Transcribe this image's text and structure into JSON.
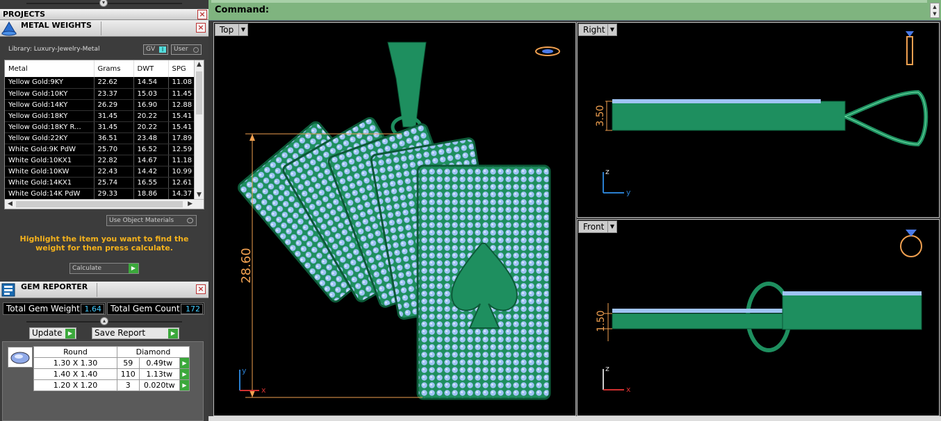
{
  "projects_panel": {
    "title": "PROJECTS"
  },
  "metal_weights": {
    "title": "METAL WEIGHTS",
    "library": "Library: Luxury-Jewelry-Metal",
    "gv_label": "GV",
    "user_label": "User",
    "columns": [
      "Metal",
      "Grams",
      "DWT",
      "SPG"
    ],
    "rows": [
      [
        "Yellow Gold:9KY",
        "22.62",
        "14.54",
        "11.08"
      ],
      [
        "Yellow Gold:10KY",
        "23.37",
        "15.03",
        "11.45"
      ],
      [
        "Yellow Gold:14KY",
        "26.29",
        "16.90",
        "12.88"
      ],
      [
        "Yellow Gold:18KY",
        "31.45",
        "20.22",
        "15.41"
      ],
      [
        "Yellow Gold:18KY R...",
        "31.45",
        "20.22",
        "15.41"
      ],
      [
        "Yellow Gold:22KY",
        "36.51",
        "23.48",
        "17.89"
      ],
      [
        "White Gold:9K PdW",
        "25.70",
        "16.52",
        "12.59"
      ],
      [
        "White Gold:10KX1",
        "22.82",
        "14.67",
        "11.18"
      ],
      [
        "White Gold:10KW",
        "22.43",
        "14.42",
        "10.99"
      ],
      [
        "White Gold:14KX1",
        "25.74",
        "16.55",
        "12.61"
      ],
      [
        "White Gold:14K PdW",
        "29.33",
        "18.86",
        "14.37"
      ]
    ],
    "use_object_materials": "Use Object Materials",
    "hint": "Highlight the item you want to find the weight for then press calculate.",
    "calculate_label": "Calculate"
  },
  "gem_reporter": {
    "title": "GEM REPORTER",
    "total_weight_label": "Total Gem Weight",
    "total_weight": "1.64",
    "total_count_label": "Total Gem Count",
    "total_count": "172",
    "update_label": "Update",
    "save_report_label": "Save Report",
    "shape": "Round",
    "material": "Diamond",
    "gems": [
      {
        "size": "1.30 X 1.30",
        "count": "59",
        "weight": "0.49tw"
      },
      {
        "size": "1.40 X 1.40",
        "count": "110",
        "weight": "1.13tw"
      },
      {
        "size": "1.20 X 1.20",
        "count": "3",
        "weight": "0.020tw"
      }
    ]
  },
  "command": {
    "label": "Command:"
  },
  "viewports": {
    "top": {
      "label": "Top",
      "dim_height": "28.60"
    },
    "right": {
      "label": "Right",
      "dim": "3.50"
    },
    "front": {
      "label": "Front",
      "dim": "1.50"
    }
  },
  "axes": {
    "x": "x",
    "y": "y",
    "z": "z"
  },
  "colors": {
    "model": "#1e8f5f",
    "gem": "#9fc4f5",
    "dim": "#f0a050",
    "accent": "#f5b21c",
    "cmd_bg": "#7fb47f"
  }
}
